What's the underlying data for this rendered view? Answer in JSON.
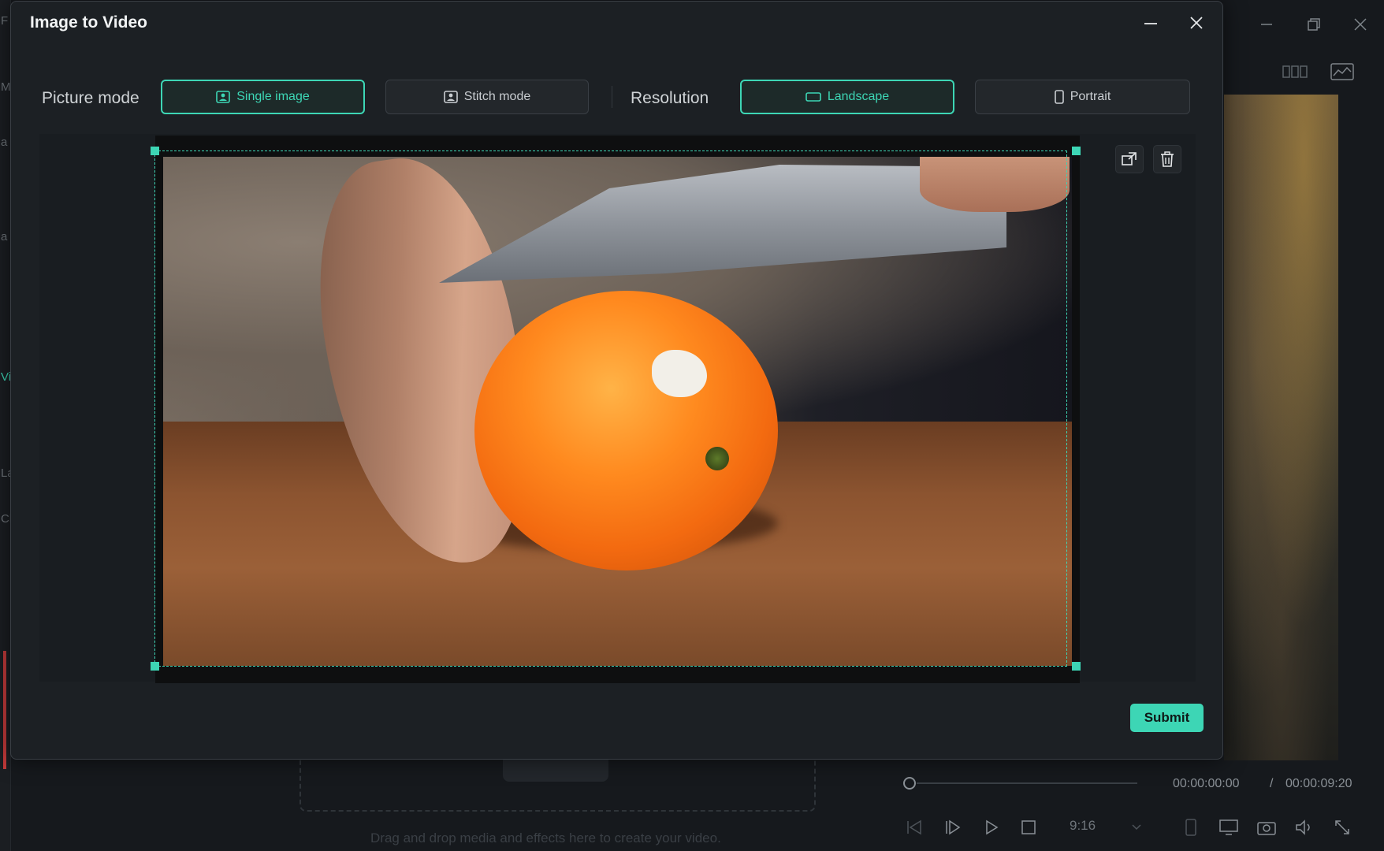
{
  "dialog": {
    "title": "Image to Video",
    "picture_mode_label": "Picture mode",
    "resolution_label": "Resolution",
    "picture_modes": [
      {
        "label": "Single image",
        "icon": "image-icon",
        "selected": true
      },
      {
        "label": "Stitch mode",
        "icon": "stitch-image-icon",
        "selected": false
      }
    ],
    "resolutions": [
      {
        "label": "Landscape",
        "icon": "landscape-icon",
        "selected": true
      },
      {
        "label": "Portrait",
        "icon": "portrait-icon",
        "selected": false
      }
    ],
    "tools": [
      "replace-image-icon",
      "trash-icon"
    ],
    "submit_label": "Submit",
    "accent_color": "#3dd6b5"
  },
  "background_app": {
    "current_time": "00:00:00:00",
    "time_separator": "/",
    "total_time": "00:00:09:20",
    "aspect_ratio": "9:16",
    "dropzone_text": "Drag and drop media and effects here to create your video.",
    "left_strip_letters": [
      "F",
      "M",
      "a",
      "a",
      "Vi",
      "La",
      "Cli"
    ]
  }
}
